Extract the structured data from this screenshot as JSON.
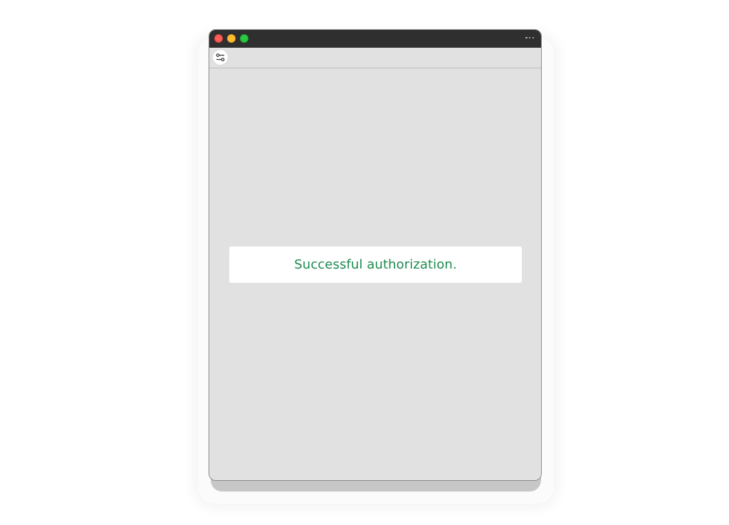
{
  "window": {
    "controls": {
      "close_icon": "close-circle-icon",
      "minimize_icon": "minimize-circle-icon",
      "maximize_icon": "maximize-circle-icon"
    },
    "more_icon": "ellipsis-icon"
  },
  "toolbar": {
    "settings_icon": "settings-sliders-icon"
  },
  "main": {
    "status_message": "Successful authorization."
  },
  "colors": {
    "status_success": "#1c8a4f",
    "titlebar": "#2f2f2f",
    "content_background": "#e1e1e1"
  }
}
